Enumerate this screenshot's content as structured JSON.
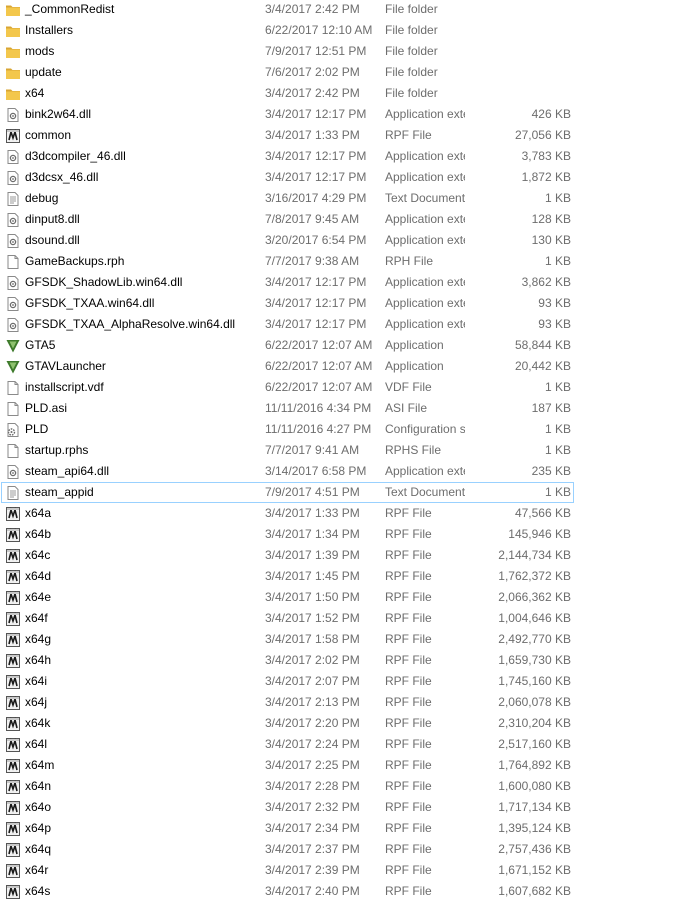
{
  "colors": {
    "folder": "#f3c74c",
    "folder_dark": "#d8a533",
    "focus_border": "#99d1ff",
    "meta_text": "#6d6d6d",
    "name_text": "#000000",
    "gta_green": "#3d7a2b"
  },
  "files": [
    {
      "name": "_CommonRedist",
      "date": "3/4/2017 2:42 PM",
      "type": "File folder",
      "size": "",
      "icon": "folder-icon"
    },
    {
      "name": "Installers",
      "date": "6/22/2017 12:10 AM",
      "type": "File folder",
      "size": "",
      "icon": "folder-icon"
    },
    {
      "name": "mods",
      "date": "7/9/2017 12:51 PM",
      "type": "File folder",
      "size": "",
      "icon": "folder-icon"
    },
    {
      "name": "update",
      "date": "7/6/2017 2:02 PM",
      "type": "File folder",
      "size": "",
      "icon": "folder-icon"
    },
    {
      "name": "x64",
      "date": "3/4/2017 2:42 PM",
      "type": "File folder",
      "size": "",
      "icon": "folder-icon"
    },
    {
      "name": "bink2w64.dll",
      "date": "3/4/2017 12:17 PM",
      "type": "Application extens...",
      "size": "426 KB",
      "icon": "dll-file-icon"
    },
    {
      "name": "common",
      "date": "3/4/2017 1:33 PM",
      "type": "RPF File",
      "size": "27,056 KB",
      "icon": "rpf-file-icon"
    },
    {
      "name": "d3dcompiler_46.dll",
      "date": "3/4/2017 12:17 PM",
      "type": "Application extens...",
      "size": "3,783 KB",
      "icon": "dll-file-icon"
    },
    {
      "name": "d3dcsx_46.dll",
      "date": "3/4/2017 12:17 PM",
      "type": "Application extens...",
      "size": "1,872 KB",
      "icon": "dll-file-icon"
    },
    {
      "name": "debug",
      "date": "3/16/2017 4:29 PM",
      "type": "Text Document",
      "size": "1 KB",
      "icon": "text-document-icon"
    },
    {
      "name": "dinput8.dll",
      "date": "7/8/2017 9:45 AM",
      "type": "Application extens...",
      "size": "128 KB",
      "icon": "dll-file-icon"
    },
    {
      "name": "dsound.dll",
      "date": "3/20/2017 6:54 PM",
      "type": "Application extens...",
      "size": "130 KB",
      "icon": "dll-file-icon"
    },
    {
      "name": "GameBackups.rph",
      "date": "7/7/2017 9:38 AM",
      "type": "RPH File",
      "size": "1 KB",
      "icon": "blank-file-icon"
    },
    {
      "name": "GFSDK_ShadowLib.win64.dll",
      "date": "3/4/2017 12:17 PM",
      "type": "Application extens...",
      "size": "3,862 KB",
      "icon": "dll-file-icon"
    },
    {
      "name": "GFSDK_TXAA.win64.dll",
      "date": "3/4/2017 12:17 PM",
      "type": "Application extens...",
      "size": "93 KB",
      "icon": "dll-file-icon"
    },
    {
      "name": "GFSDK_TXAA_AlphaResolve.win64.dll",
      "date": "3/4/2017 12:17 PM",
      "type": "Application extens...",
      "size": "93 KB",
      "icon": "dll-file-icon"
    },
    {
      "name": "GTA5",
      "date": "6/22/2017 12:07 AM",
      "type": "Application",
      "size": "58,844 KB",
      "icon": "gta-v-icon"
    },
    {
      "name": "GTAVLauncher",
      "date": "6/22/2017 12:07 AM",
      "type": "Application",
      "size": "20,442 KB",
      "icon": "gta-v-icon"
    },
    {
      "name": "installscript.vdf",
      "date": "6/22/2017 12:07 AM",
      "type": "VDF File",
      "size": "1 KB",
      "icon": "blank-file-icon"
    },
    {
      "name": "PLD.asi",
      "date": "11/11/2016 4:34 PM",
      "type": "ASI File",
      "size": "187 KB",
      "icon": "blank-file-icon"
    },
    {
      "name": "PLD",
      "date": "11/11/2016 4:27 PM",
      "type": "Configuration sett...",
      "size": "1 KB",
      "icon": "config-file-icon"
    },
    {
      "name": "startup.rphs",
      "date": "7/7/2017 9:41 AM",
      "type": "RPHS File",
      "size": "1 KB",
      "icon": "blank-file-icon"
    },
    {
      "name": "steam_api64.dll",
      "date": "3/14/2017 6:58 PM",
      "type": "Application extens...",
      "size": "235 KB",
      "icon": "dll-file-icon"
    },
    {
      "name": "steam_appid",
      "date": "7/9/2017 4:51 PM",
      "type": "Text Document",
      "size": "1 KB",
      "icon": "text-document-icon",
      "focused": true
    },
    {
      "name": "x64a",
      "date": "3/4/2017 1:33 PM",
      "type": "RPF File",
      "size": "47,566 KB",
      "icon": "rpf-file-icon"
    },
    {
      "name": "x64b",
      "date": "3/4/2017 1:34 PM",
      "type": "RPF File",
      "size": "145,946 KB",
      "icon": "rpf-file-icon"
    },
    {
      "name": "x64c",
      "date": "3/4/2017 1:39 PM",
      "type": "RPF File",
      "size": "2,144,734 KB",
      "icon": "rpf-file-icon"
    },
    {
      "name": "x64d",
      "date": "3/4/2017 1:45 PM",
      "type": "RPF File",
      "size": "1,762,372 KB",
      "icon": "rpf-file-icon"
    },
    {
      "name": "x64e",
      "date": "3/4/2017 1:50 PM",
      "type": "RPF File",
      "size": "2,066,362 KB",
      "icon": "rpf-file-icon"
    },
    {
      "name": "x64f",
      "date": "3/4/2017 1:52 PM",
      "type": "RPF File",
      "size": "1,004,646 KB",
      "icon": "rpf-file-icon"
    },
    {
      "name": "x64g",
      "date": "3/4/2017 1:58 PM",
      "type": "RPF File",
      "size": "2,492,770 KB",
      "icon": "rpf-file-icon"
    },
    {
      "name": "x64h",
      "date": "3/4/2017 2:02 PM",
      "type": "RPF File",
      "size": "1,659,730 KB",
      "icon": "rpf-file-icon"
    },
    {
      "name": "x64i",
      "date": "3/4/2017 2:07 PM",
      "type": "RPF File",
      "size": "1,745,160 KB",
      "icon": "rpf-file-icon"
    },
    {
      "name": "x64j",
      "date": "3/4/2017 2:13 PM",
      "type": "RPF File",
      "size": "2,060,078 KB",
      "icon": "rpf-file-icon"
    },
    {
      "name": "x64k",
      "date": "3/4/2017 2:20 PM",
      "type": "RPF File",
      "size": "2,310,204 KB",
      "icon": "rpf-file-icon"
    },
    {
      "name": "x64l",
      "date": "3/4/2017 2:24 PM",
      "type": "RPF File",
      "size": "2,517,160 KB",
      "icon": "rpf-file-icon"
    },
    {
      "name": "x64m",
      "date": "3/4/2017 2:25 PM",
      "type": "RPF File",
      "size": "1,764,892 KB",
      "icon": "rpf-file-icon"
    },
    {
      "name": "x64n",
      "date": "3/4/2017 2:28 PM",
      "type": "RPF File",
      "size": "1,600,080 KB",
      "icon": "rpf-file-icon"
    },
    {
      "name": "x64o",
      "date": "3/4/2017 2:32 PM",
      "type": "RPF File",
      "size": "1,717,134 KB",
      "icon": "rpf-file-icon"
    },
    {
      "name": "x64p",
      "date": "3/4/2017 2:34 PM",
      "type": "RPF File",
      "size": "1,395,124 KB",
      "icon": "rpf-file-icon"
    },
    {
      "name": "x64q",
      "date": "3/4/2017 2:37 PM",
      "type": "RPF File",
      "size": "2,757,436 KB",
      "icon": "rpf-file-icon"
    },
    {
      "name": "x64r",
      "date": "3/4/2017 2:39 PM",
      "type": "RPF File",
      "size": "1,671,152 KB",
      "icon": "rpf-file-icon"
    },
    {
      "name": "x64s",
      "date": "3/4/2017 2:40 PM",
      "type": "RPF File",
      "size": "1,607,682 KB",
      "icon": "rpf-file-icon"
    }
  ]
}
